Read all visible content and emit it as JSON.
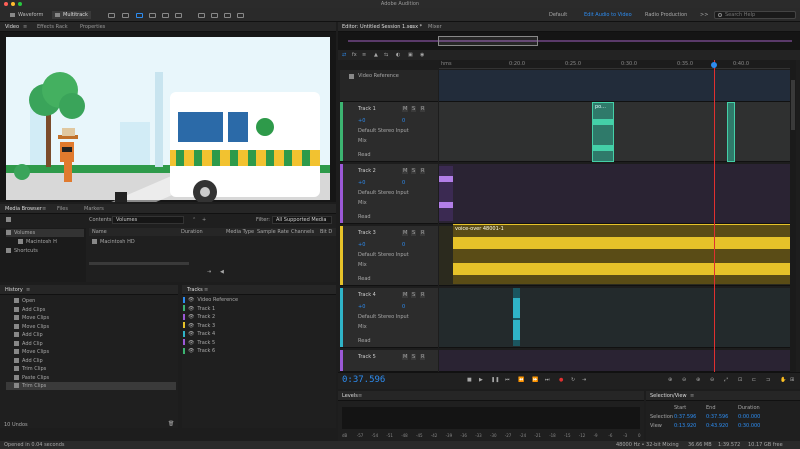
{
  "window": {
    "title": "Adobe Audition"
  },
  "toolbar": {
    "waveform": "Waveform",
    "multitrack": "Multitrack",
    "workspaces": [
      "Default",
      "Edit Audio to Video",
      "Radio Production"
    ],
    "search_placeholder": "Search Help",
    "more": ">>"
  },
  "video_panel": {
    "tabs": [
      "Video",
      "Effects Rack",
      "Properties"
    ]
  },
  "media_browser": {
    "tabs": [
      "Media Browser",
      "Files",
      "Markers"
    ],
    "contents_label": "Contents:",
    "contents_value": "Volumes",
    "filter_label": "Filter:",
    "filter_value": "All Supported Media",
    "tree": [
      "Volumes",
      "Macintosh H",
      "Shortcuts"
    ],
    "columns": [
      "Name",
      "Duration",
      "Media Type",
      "Sample Rate",
      "Channels",
      "Bit D"
    ],
    "items": [
      "Macintosh HD"
    ]
  },
  "history": {
    "title": "History",
    "items": [
      "Open",
      "Add Clips",
      "Move Clips",
      "Move Clips",
      "Add Clip",
      "Add Clip",
      "Move Clips",
      "Add Clip",
      "Trim Clips",
      "Paste Clips",
      "Trim Clips"
    ],
    "undos": "10 Undos"
  },
  "tracks_panel": {
    "title": "Tracks",
    "items": [
      "Video Reference",
      "Track 1",
      "Track 2",
      "Track 3",
      "Track 4",
      "Track 5",
      "Track 6"
    ]
  },
  "editor": {
    "tabs": [
      "Editor: Untitled Session 1.sesx *",
      "Mixer"
    ],
    "ruler": [
      "hms",
      "0:20.0",
      "0:25.0",
      "0:30.0",
      "0:35.0",
      "0:40.0"
    ],
    "video_ref": "Video Reference",
    "clip_label": "voice-over 48001-1",
    "clip_small": "po...",
    "tracks": [
      {
        "name": "Track 1",
        "vol": "+0",
        "pan": "0",
        "input": "Default Stereo Input",
        "mix": "Mix",
        "read": "Read",
        "color": "#3cb371"
      },
      {
        "name": "Track 2",
        "vol": "+0",
        "pan": "0",
        "input": "Default Stereo Input",
        "mix": "Mix",
        "read": "Read",
        "color": "#9b59d6"
      },
      {
        "name": "Track 3",
        "vol": "+0",
        "pan": "0",
        "input": "Default Stereo Input",
        "mix": "Mix",
        "read": "Read",
        "color": "#e6c229"
      },
      {
        "name": "Track 4",
        "vol": "+0",
        "pan": "0",
        "input": "Default Stereo Input",
        "mix": "Mix",
        "read": "Read",
        "color": "#2fb3c7"
      },
      {
        "name": "Track 5",
        "vol": "",
        "pan": "",
        "input": "",
        "mix": "",
        "read": "",
        "color": "#9b59d6"
      }
    ]
  },
  "transport": {
    "time": "0:37.596"
  },
  "levels": {
    "title": "Levels",
    "scale": [
      "dB",
      "-57",
      "-54",
      "-51",
      "-48",
      "-45",
      "-42",
      "-39",
      "-36",
      "-33",
      "-30",
      "-27",
      "-24",
      "-21",
      "-18",
      "-15",
      "-12",
      "-9",
      "-6",
      "-3",
      "0"
    ]
  },
  "selection_view": {
    "title": "Selection/View",
    "headers": [
      "Start",
      "End",
      "Duration"
    ],
    "selection_label": "Selection",
    "selection": [
      "0:37.596",
      "0:37.596",
      "0:00.000"
    ],
    "view_label": "View",
    "view": [
      "0:13.920",
      "0:43.920",
      "0:30.000"
    ]
  },
  "status": {
    "left": "Opened in 0.04 seconds",
    "items": [
      "48000 Hz • 32-bit Mixing",
      "36.66 MB",
      "1:39.572",
      "10.17 GB free"
    ]
  },
  "colors": {
    "accent": "#2d8cf0",
    "playhead": "#e03030"
  }
}
